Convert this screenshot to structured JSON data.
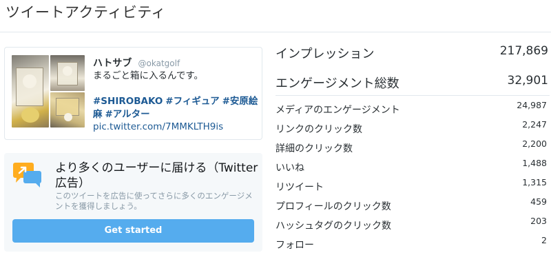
{
  "page": {
    "title": "ツイートアクティビティ"
  },
  "tweet": {
    "name": "ハトサブ",
    "handle": "@okatgolf",
    "text": "まるごと箱に入るんです。",
    "hashtags": [
      "#SHIROBAKO",
      "#フィギュア",
      "#安原絵麻",
      "#アルター"
    ],
    "link": "pic.twitter.com/7MMKLTH9is",
    "images": [
      "photo",
      "photo",
      "photo"
    ]
  },
  "promo": {
    "title": "より多くのユーザーに届ける（Twitter広告）",
    "description": "このツイートを広告に使ってさらに多くのエンゲージメントを獲得しましょう。",
    "button_label": "Get started",
    "icon": "speech-bubbles-icon",
    "accent_color": "#55acee",
    "icon_colors": [
      "#ffad1f",
      "#55acee"
    ]
  },
  "metrics": {
    "impressions": {
      "label": "インプレッション",
      "value": "217,869"
    },
    "engagements": {
      "label": "エンゲージメント総数",
      "value": "32,901"
    },
    "rows": [
      {
        "label": "メディアのエンゲージメント",
        "value": "24,987"
      },
      {
        "label": "リンクのクリック数",
        "value": "2,247"
      },
      {
        "label": "詳細のクリック数",
        "value": "2,200"
      },
      {
        "label": "いいね",
        "value": "1,488"
      },
      {
        "label": "リツイート",
        "value": "1,315"
      },
      {
        "label": "プロフィールのクリック数",
        "value": "459"
      },
      {
        "label": "ハッシュタグのクリック数",
        "value": "203"
      },
      {
        "label": "フォロー",
        "value": "2"
      }
    ]
  }
}
